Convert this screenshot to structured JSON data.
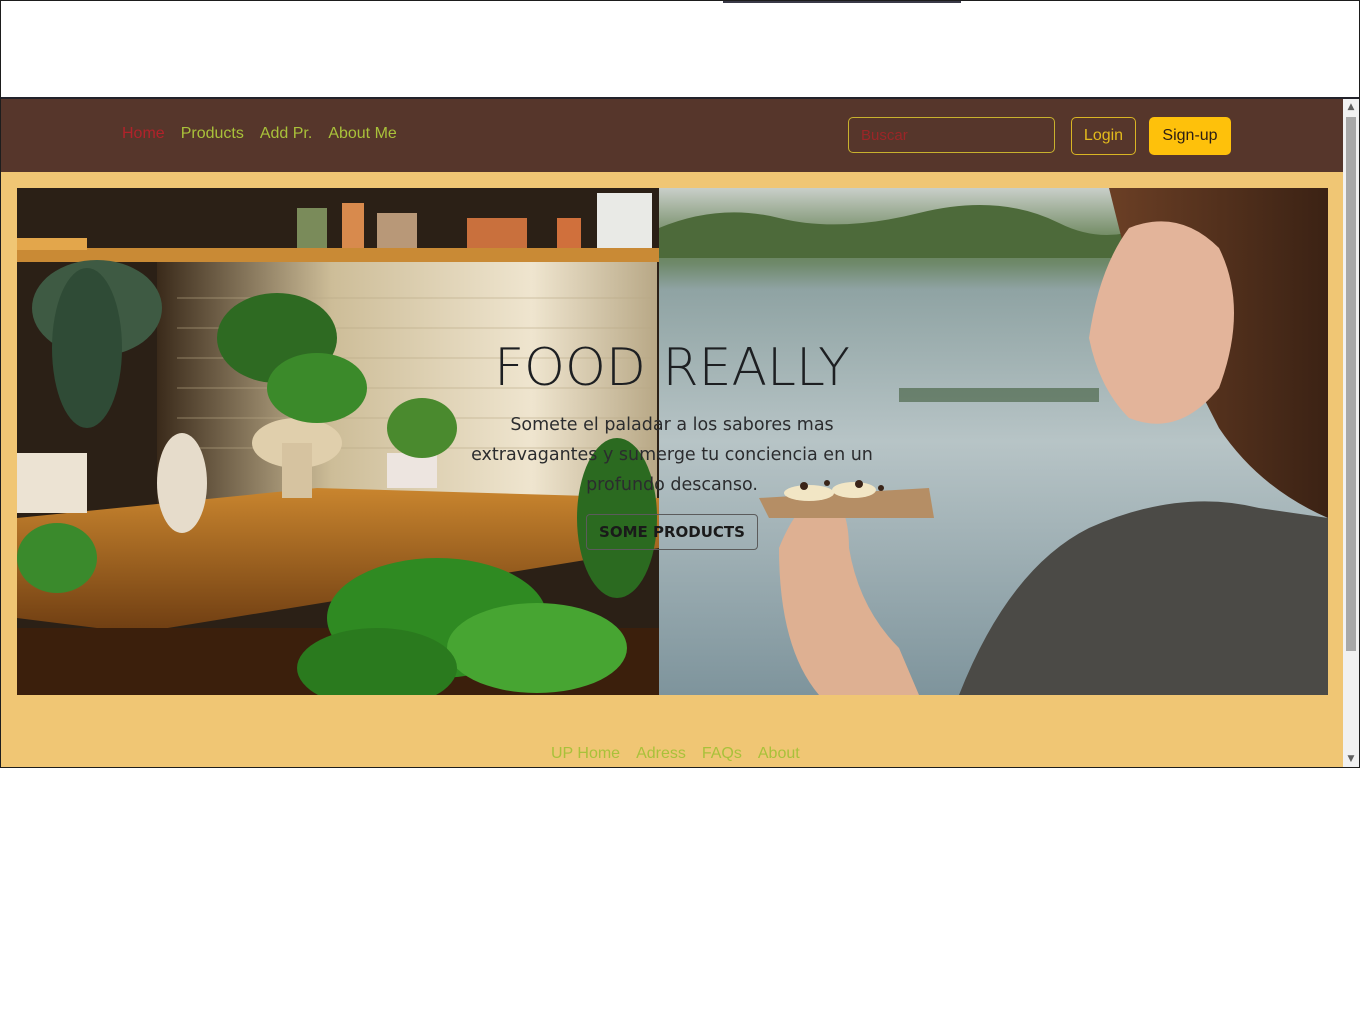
{
  "navbar": {
    "links": [
      {
        "label": "Home",
        "active": true
      },
      {
        "label": "Products"
      },
      {
        "label": "Add Pr."
      },
      {
        "label": "About Me"
      }
    ],
    "search_placeholder": "Buscar",
    "login_label": "Login",
    "signup_label": "Sign-up"
  },
  "hero": {
    "title": "FOOD REALLY",
    "subtitle": "Somete el paladar a los sabores mas extravagantes y sumerge tu conciencia en un profundo descanso.",
    "button_label": "SOME PRODUCTS"
  },
  "footer": {
    "links": [
      "UP Home",
      "Adress",
      "FAQs",
      "About"
    ]
  },
  "colors": {
    "navbar_bg": "#56362b",
    "page_bg": "#f0c674",
    "link_green": "#a9c13a",
    "active_red": "#b1222a",
    "signup_yellow": "#fec10b"
  }
}
